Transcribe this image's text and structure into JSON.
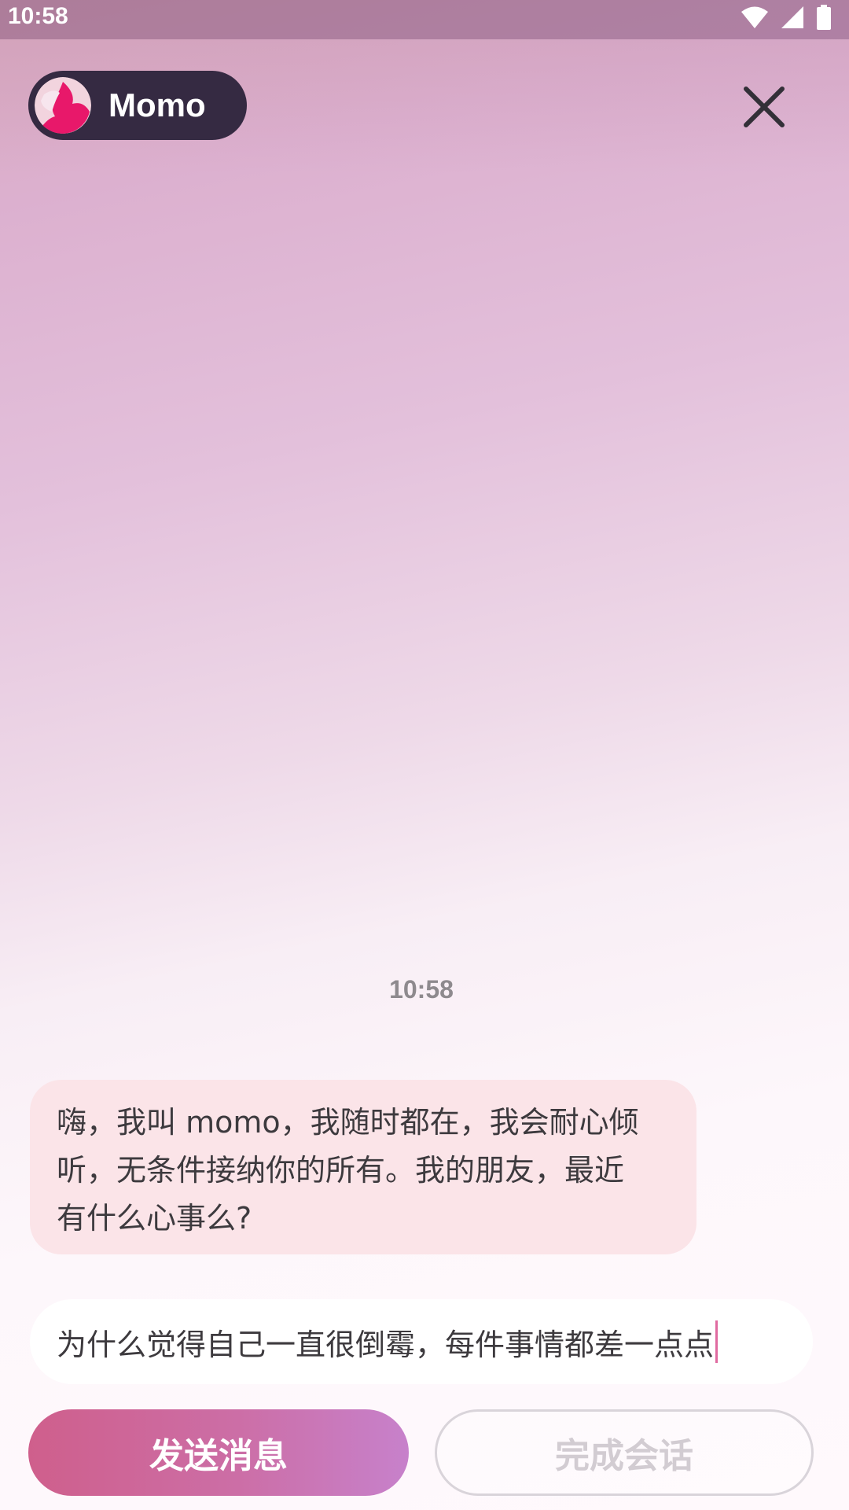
{
  "status_bar": {
    "time": "10:58"
  },
  "header": {
    "assistant_name": "Momo",
    "avatar_icon": "momo-avatar-icon",
    "close_icon": "close-icon"
  },
  "chat": {
    "timestamp": "10:58",
    "messages": [
      {
        "sender": "assistant",
        "lines": [
          "嗨，我叫 momo，我随时都在，我会耐心倾",
          "听，无条件接纳你的所有。我的朋友，最近",
          "有什么心事么?"
        ]
      }
    ]
  },
  "composer": {
    "input_value": "为什么觉得自己一直很倒霉，每件事情都差一点点"
  },
  "actions": {
    "send_label": "发送消息",
    "finish_label": "完成会话"
  },
  "colors": {
    "bubble_bg": "#fbe4e8",
    "send_gradient_start": "#cf5f8c",
    "send_gradient_end": "#c781cb",
    "pill_bg": "#352a42"
  }
}
